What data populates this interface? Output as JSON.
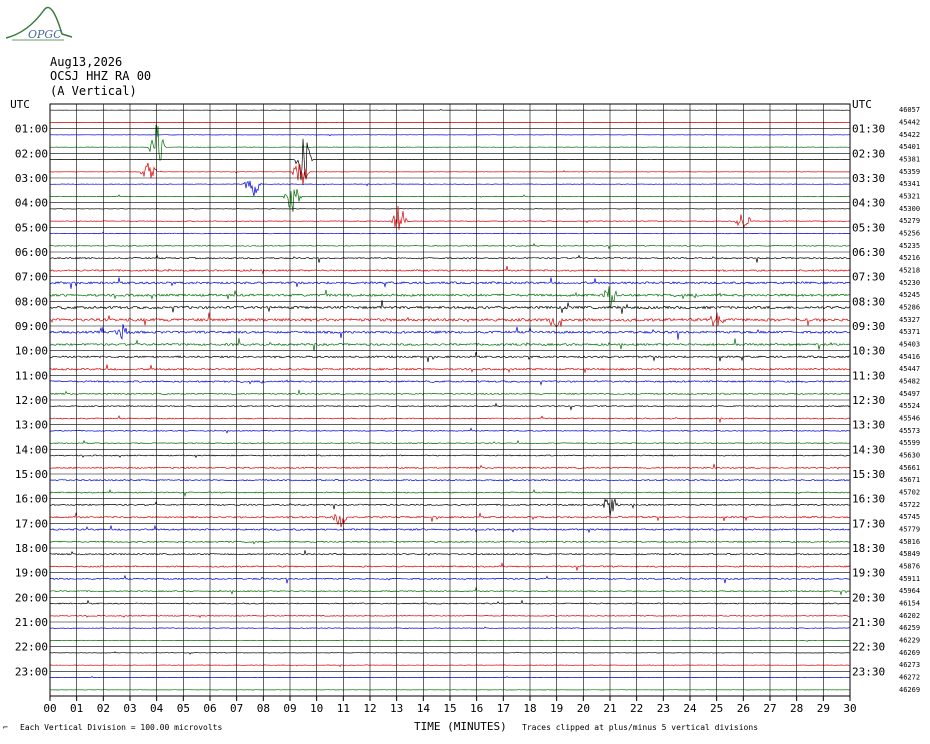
{
  "logo": {
    "text": "OPGC",
    "color": "#3a7a3a"
  },
  "header": {
    "date": "Aug13,2026",
    "station": "OCSJ HHZ RA 00",
    "component": "(A Vertical)"
  },
  "axes": {
    "left_label": "UTC",
    "right_label": "UTC",
    "xlabel": "TIME (MINUTES)"
  },
  "footer": {
    "left_note": "Each Vertical Division = 100.00 microvolts",
    "right_note": "Traces clipped at plus/minus 5 vertical divisions",
    "corner_mark": "⌐"
  },
  "colors": {
    "trace_cycle": [
      "#000000",
      "#e00000",
      "#0000e0",
      "#007000"
    ],
    "grid": "#000000"
  },
  "chart_data": {
    "type": "line",
    "title": "",
    "x_ticks": [
      "00",
      "01",
      "02",
      "03",
      "04",
      "05",
      "06",
      "07",
      "08",
      "09",
      "10",
      "11",
      "12",
      "13",
      "14",
      "15",
      "16",
      "17",
      "18",
      "19",
      "20",
      "21",
      "22",
      "23",
      "24",
      "25",
      "26",
      "27",
      "28",
      "29",
      "30"
    ],
    "xlim": [
      0,
      30
    ],
    "left_hour_labels": [
      "UTC",
      "01:00",
      "02:00",
      "03:00",
      "04:00",
      "05:00",
      "06:00",
      "07:00",
      "08:00",
      "09:00",
      "10:00",
      "11:00",
      "12:00",
      "13:00",
      "14:00",
      "15:00",
      "16:00",
      "17:00",
      "18:00",
      "19:00",
      "20:00",
      "21:00",
      "22:00",
      "23:00"
    ],
    "right_hour_labels": [
      "UTC",
      "01:30",
      "02:30",
      "03:30",
      "04:30",
      "05:30",
      "06:30",
      "07:30",
      "08:30",
      "09:30",
      "10:30",
      "11:30",
      "12:30",
      "13:30",
      "14:30",
      "15:30",
      "16:30",
      "17:30",
      "18:30",
      "19:30",
      "20:30",
      "21:30",
      "22:30",
      "23:30"
    ],
    "trace_counts": [
      "46057",
      "45442",
      "45422",
      "45401",
      "45381",
      "45359",
      "45341",
      "45321",
      "45300",
      "45279",
      "45256",
      "45235",
      "45216",
      "45218",
      "45230",
      "45245",
      "45286",
      "45327",
      "45371",
      "45403",
      "45416",
      "45447",
      "45482",
      "45497",
      "45524",
      "45546",
      "45573",
      "45599",
      "45630",
      "45661",
      "45671",
      "45702",
      "45722",
      "45745",
      "45779",
      "45816",
      "45849",
      "45876",
      "45911",
      "45964",
      "46154",
      "46202",
      "46259",
      "46229",
      "46269",
      "46273",
      "46272",
      "46269"
    ],
    "activity_levels": [
      0.1,
      0.1,
      0.15,
      0.2,
      0.15,
      0.15,
      0.2,
      0.25,
      0.2,
      0.3,
      0.3,
      0.4,
      0.6,
      0.7,
      0.9,
      1.0,
      1.1,
      1.2,
      1.0,
      0.9,
      0.8,
      0.8,
      0.7,
      0.6,
      0.5,
      0.5,
      0.4,
      0.4,
      0.5,
      0.6,
      0.6,
      0.5,
      0.6,
      0.7,
      0.7,
      0.6,
      0.6,
      0.6,
      0.6,
      0.5,
      0.5,
      0.4,
      0.3,
      0.25,
      0.2,
      0.2,
      0.15,
      0.15
    ],
    "events": [
      {
        "trace": 3,
        "minute": 4.0,
        "amp": 3.5
      },
      {
        "trace": 4,
        "minute": 9.5,
        "amp": 4.0
      },
      {
        "trace": 5,
        "minute": 3.7,
        "amp": 1.5
      },
      {
        "trace": 5,
        "minute": 9.4,
        "amp": 2.5
      },
      {
        "trace": 6,
        "minute": 7.6,
        "amp": 2.0
      },
      {
        "trace": 7,
        "minute": 9.1,
        "amp": 2.5
      },
      {
        "trace": 9,
        "minute": 13.1,
        "amp": 2.5
      },
      {
        "trace": 9,
        "minute": 26.0,
        "amp": 1.5
      },
      {
        "trace": 15,
        "minute": 21.0,
        "amp": 2.0
      },
      {
        "trace": 17,
        "minute": 19.0,
        "amp": 1.8
      },
      {
        "trace": 17,
        "minute": 25.0,
        "amp": 1.2
      },
      {
        "trace": 18,
        "minute": 2.7,
        "amp": 1.2
      },
      {
        "trace": 33,
        "minute": 10.9,
        "amp": 1.5
      },
      {
        "trace": 32,
        "minute": 21.0,
        "amp": 1.8
      }
    ]
  }
}
